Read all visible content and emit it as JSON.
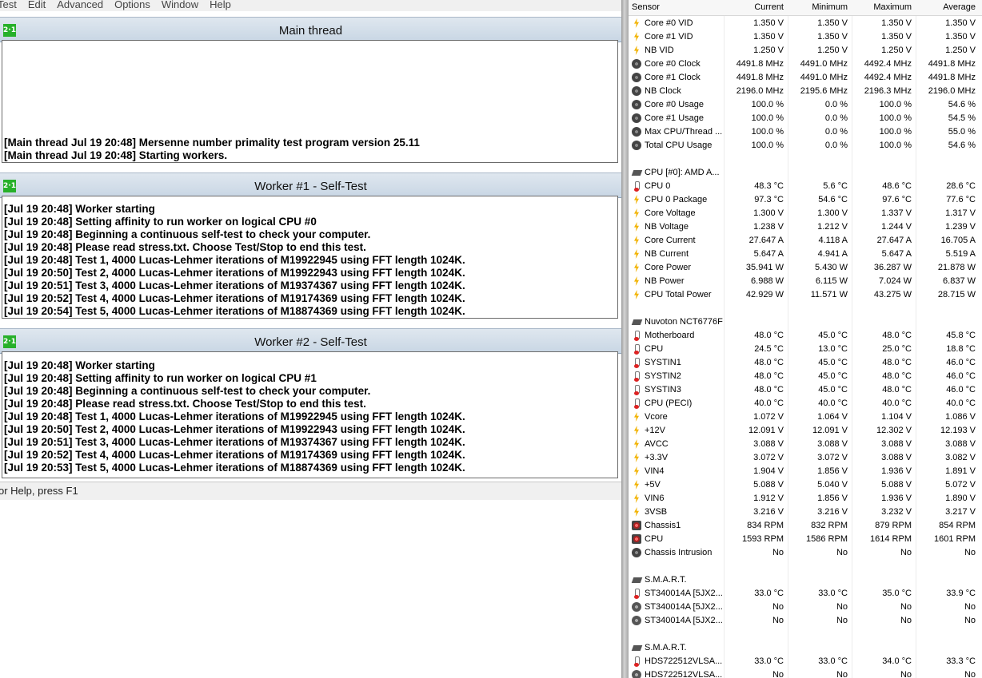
{
  "menu": [
    "Test",
    "Edit",
    "Advanced",
    "Options",
    "Window",
    "Help"
  ],
  "panes": [
    {
      "title": "Main thread",
      "lines": [
        "[Main thread Jul 19 20:48] Mersenne number primality test program version 25.11",
        "[Main thread Jul 19 20:48] Starting workers."
      ]
    },
    {
      "title": "Worker #1 - Self-Test",
      "lines": [
        "[Jul 19 20:48] Worker starting",
        "[Jul 19 20:48] Setting affinity to run worker on logical CPU #0",
        "[Jul 19 20:48] Beginning a continuous self-test to check your computer.",
        "[Jul 19 20:48] Please read stress.txt.  Choose Test/Stop to end this test.",
        "[Jul 19 20:48] Test 1, 4000 Lucas-Lehmer iterations of M19922945 using FFT length 1024K.",
        "[Jul 19 20:50] Test 2, 4000 Lucas-Lehmer iterations of M19922943 using FFT length 1024K.",
        "[Jul 19 20:51] Test 3, 4000 Lucas-Lehmer iterations of M19374367 using FFT length 1024K.",
        "[Jul 19 20:52] Test 4, 4000 Lucas-Lehmer iterations of M19174369 using FFT length 1024K.",
        "[Jul 19 20:54] Test 5, 4000 Lucas-Lehmer iterations of M18874369 using FFT length 1024K."
      ]
    },
    {
      "title": "Worker #2 - Self-Test",
      "lines": [
        "[Jul 19 20:48] Worker starting",
        "[Jul 19 20:48] Setting affinity to run worker on logical CPU #1",
        "[Jul 19 20:48] Beginning a continuous self-test to check your computer.",
        "[Jul 19 20:48] Please read stress.txt.  Choose Test/Stop to end this test.",
        "[Jul 19 20:48] Test 1, 4000 Lucas-Lehmer iterations of M19922945 using FFT length 1024K.",
        "[Jul 19 20:50] Test 2, 4000 Lucas-Lehmer iterations of M19922943 using FFT length 1024K.",
        "[Jul 19 20:51] Test 3, 4000 Lucas-Lehmer iterations of M19374367 using FFT length 1024K.",
        "[Jul 19 20:52] Test 4, 4000 Lucas-Lehmer iterations of M19174369 using FFT length 1024K.",
        "[Jul 19 20:53] Test 5, 4000 Lucas-Lehmer iterations of M18874369 using FFT length 1024K."
      ]
    }
  ],
  "icon_text": "2·1",
  "status": "or Help, press F1",
  "sensor_header": [
    "Sensor",
    "Current",
    "Minimum",
    "Maximum",
    "Average"
  ],
  "sensor_rows": [
    {
      "icon": "volt",
      "name": "Core #0 VID",
      "v": [
        "1.350 V",
        "1.350 V",
        "1.350 V",
        "1.350 V"
      ]
    },
    {
      "icon": "volt",
      "name": "Core #1 VID",
      "v": [
        "1.350 V",
        "1.350 V",
        "1.350 V",
        "1.350 V"
      ]
    },
    {
      "icon": "volt",
      "name": "NB VID",
      "v": [
        "1.250 V",
        "1.250 V",
        "1.250 V",
        "1.250 V"
      ]
    },
    {
      "icon": "clock",
      "name": "Core #0 Clock",
      "v": [
        "4491.8 MHz",
        "4491.0 MHz",
        "4492.4 MHz",
        "4491.8 MHz"
      ]
    },
    {
      "icon": "clock",
      "name": "Core #1 Clock",
      "v": [
        "4491.8 MHz",
        "4491.0 MHz",
        "4492.4 MHz",
        "4491.8 MHz"
      ]
    },
    {
      "icon": "clock",
      "name": "NB Clock",
      "v": [
        "2196.0 MHz",
        "2195.6 MHz",
        "2196.3 MHz",
        "2196.0 MHz"
      ]
    },
    {
      "icon": "clock",
      "name": "Core #0 Usage",
      "v": [
        "100.0 %",
        "0.0 %",
        "100.0 %",
        "54.6 %"
      ]
    },
    {
      "icon": "clock",
      "name": "Core #1 Usage",
      "v": [
        "100.0 %",
        "0.0 %",
        "100.0 %",
        "54.5 %"
      ]
    },
    {
      "icon": "clock",
      "name": "Max CPU/Thread ...",
      "v": [
        "100.0 %",
        "0.0 %",
        "100.0 %",
        "55.0 %"
      ]
    },
    {
      "icon": "clock",
      "name": "Total CPU Usage",
      "v": [
        "100.0 %",
        "0.0 %",
        "100.0 %",
        "54.6 %"
      ]
    },
    {
      "icon": "",
      "name": "",
      "v": [
        "",
        "",
        "",
        ""
      ]
    },
    {
      "icon": "chip",
      "name": "CPU [#0]: AMD A...",
      "v": [
        "",
        "",
        "",
        ""
      ],
      "group": true
    },
    {
      "icon": "temp",
      "name": "CPU 0",
      "v": [
        "48.3 °C",
        "5.6 °C",
        "48.6 °C",
        "28.6 °C"
      ]
    },
    {
      "icon": "volt",
      "name": "CPU 0 Package",
      "v": [
        "97.3 °C",
        "54.6 °C",
        "97.6 °C",
        "77.6 °C"
      ]
    },
    {
      "icon": "volt",
      "name": "Core Voltage",
      "v": [
        "1.300 V",
        "1.300 V",
        "1.337 V",
        "1.317 V"
      ]
    },
    {
      "icon": "volt",
      "name": "NB Voltage",
      "v": [
        "1.238 V",
        "1.212 V",
        "1.244 V",
        "1.239 V"
      ]
    },
    {
      "icon": "volt",
      "name": "Core Current",
      "v": [
        "27.647 A",
        "4.118 A",
        "27.647 A",
        "16.705 A"
      ]
    },
    {
      "icon": "volt",
      "name": "NB Current",
      "v": [
        "5.647 A",
        "4.941 A",
        "5.647 A",
        "5.519 A"
      ]
    },
    {
      "icon": "volt",
      "name": "Core Power",
      "v": [
        "35.941 W",
        "5.430 W",
        "36.287 W",
        "21.878 W"
      ]
    },
    {
      "icon": "volt",
      "name": "NB Power",
      "v": [
        "6.988 W",
        "6.115 W",
        "7.024 W",
        "6.837 W"
      ]
    },
    {
      "icon": "volt",
      "name": "CPU Total Power",
      "v": [
        "42.929 W",
        "11.571 W",
        "43.275 W",
        "28.715 W"
      ]
    },
    {
      "icon": "",
      "name": "",
      "v": [
        "",
        "",
        "",
        ""
      ]
    },
    {
      "icon": "chip",
      "name": "Nuvoton NCT6776F",
      "v": [
        "",
        "",
        "",
        ""
      ],
      "group": true
    },
    {
      "icon": "temp",
      "name": "Motherboard",
      "v": [
        "48.0 °C",
        "45.0 °C",
        "48.0 °C",
        "45.8 °C"
      ]
    },
    {
      "icon": "temp",
      "name": "CPU",
      "v": [
        "24.5 °C",
        "13.0 °C",
        "25.0 °C",
        "18.8 °C"
      ]
    },
    {
      "icon": "temp",
      "name": "SYSTIN1",
      "v": [
        "48.0 °C",
        "45.0 °C",
        "48.0 °C",
        "46.0 °C"
      ]
    },
    {
      "icon": "temp",
      "name": "SYSTIN2",
      "v": [
        "48.0 °C",
        "45.0 °C",
        "48.0 °C",
        "46.0 °C"
      ]
    },
    {
      "icon": "temp",
      "name": "SYSTIN3",
      "v": [
        "48.0 °C",
        "45.0 °C",
        "48.0 °C",
        "46.0 °C"
      ]
    },
    {
      "icon": "temp",
      "name": "CPU (PECI)",
      "v": [
        "40.0 °C",
        "40.0 °C",
        "40.0 °C",
        "40.0 °C"
      ]
    },
    {
      "icon": "volt",
      "name": "Vcore",
      "v": [
        "1.072 V",
        "1.064 V",
        "1.104 V",
        "1.086 V"
      ]
    },
    {
      "icon": "volt",
      "name": "+12V",
      "v": [
        "12.091 V",
        "12.091 V",
        "12.302 V",
        "12.193 V"
      ]
    },
    {
      "icon": "volt",
      "name": "AVCC",
      "v": [
        "3.088 V",
        "3.088 V",
        "3.088 V",
        "3.088 V"
      ]
    },
    {
      "icon": "volt",
      "name": "+3.3V",
      "v": [
        "3.072 V",
        "3.072 V",
        "3.088 V",
        "3.082 V"
      ]
    },
    {
      "icon": "volt",
      "name": "VIN4",
      "v": [
        "1.904 V",
        "1.856 V",
        "1.936 V",
        "1.891 V"
      ]
    },
    {
      "icon": "volt",
      "name": "+5V",
      "v": [
        "5.088 V",
        "5.040 V",
        "5.088 V",
        "5.072 V"
      ]
    },
    {
      "icon": "volt",
      "name": "VIN6",
      "v": [
        "1.912 V",
        "1.856 V",
        "1.936 V",
        "1.890 V"
      ]
    },
    {
      "icon": "volt",
      "name": "3VSB",
      "v": [
        "3.216 V",
        "3.216 V",
        "3.232 V",
        "3.217 V"
      ]
    },
    {
      "icon": "fan",
      "name": "Chassis1",
      "v": [
        "834 RPM",
        "832 RPM",
        "879 RPM",
        "854 RPM"
      ]
    },
    {
      "icon": "fan",
      "name": "CPU",
      "v": [
        "1593 RPM",
        "1586 RPM",
        "1614 RPM",
        "1601 RPM"
      ]
    },
    {
      "icon": "clock",
      "name": "Chassis Intrusion",
      "v": [
        "No",
        "No",
        "No",
        "No"
      ]
    },
    {
      "icon": "",
      "name": "",
      "v": [
        "",
        "",
        "",
        ""
      ]
    },
    {
      "icon": "chip",
      "name": "S.M.A.R.T.",
      "v": [
        "",
        "",
        "",
        ""
      ],
      "group": true
    },
    {
      "icon": "temp",
      "name": "ST340014A [5JX2...",
      "v": [
        "33.0 °C",
        "33.0 °C",
        "35.0 °C",
        "33.9 °C"
      ]
    },
    {
      "icon": "disk",
      "name": "ST340014A [5JX2...",
      "v": [
        "No",
        "No",
        "No",
        "No"
      ]
    },
    {
      "icon": "disk",
      "name": "ST340014A [5JX2...",
      "v": [
        "No",
        "No",
        "No",
        "No"
      ]
    },
    {
      "icon": "",
      "name": "",
      "v": [
        "",
        "",
        "",
        ""
      ]
    },
    {
      "icon": "chip",
      "name": "S.M.A.R.T.",
      "v": [
        "",
        "",
        "",
        ""
      ],
      "group": true
    },
    {
      "icon": "temp",
      "name": "HDS722512VLSA...",
      "v": [
        "33.0 °C",
        "33.0 °C",
        "34.0 °C",
        "33.3 °C"
      ]
    },
    {
      "icon": "disk",
      "name": "HDS722512VLSA...",
      "v": [
        "No",
        "No",
        "No",
        "No"
      ]
    }
  ]
}
